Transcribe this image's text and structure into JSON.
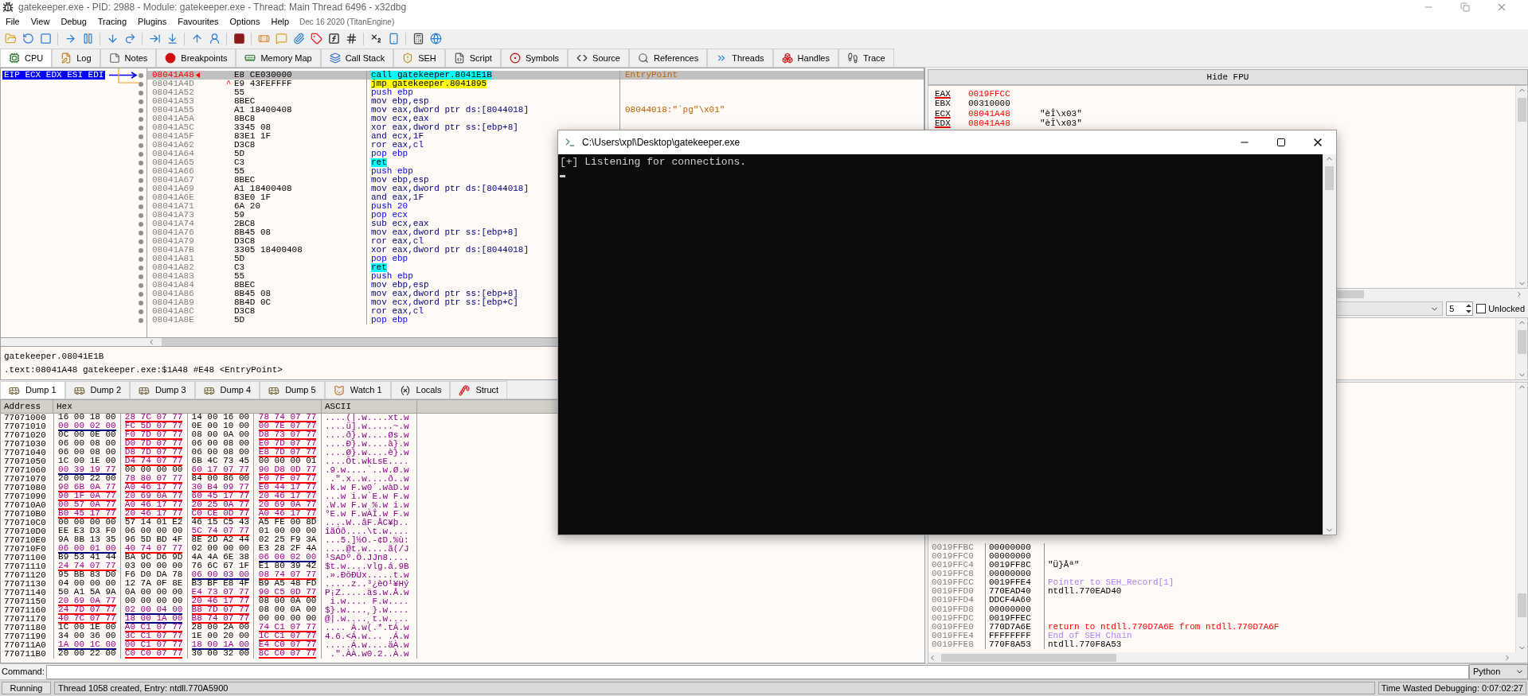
{
  "window": {
    "title": "gatekeeper.exe - PID: 2988 - Module: gatekeeper.exe - Thread: Main Thread 6496 - x32dbg"
  },
  "menu": [
    "File",
    "View",
    "Debug",
    "Tracing",
    "Plugins",
    "Favourites",
    "Options",
    "Help"
  ],
  "build_info": "Dec 16 2020 (TitanEngine)",
  "tabs": [
    {
      "label": "CPU",
      "selected": true
    },
    {
      "label": "Log",
      "selected": false
    },
    {
      "label": "Notes",
      "selected": false
    },
    {
      "label": "Breakpoints",
      "selected": false
    },
    {
      "label": "Memory Map",
      "selected": false
    },
    {
      "label": "Call Stack",
      "selected": false
    },
    {
      "label": "SEH",
      "selected": false
    },
    {
      "label": "Script",
      "selected": false
    },
    {
      "label": "Symbols",
      "selected": false
    },
    {
      "label": "Source",
      "selected": false
    },
    {
      "label": "References",
      "selected": false
    },
    {
      "label": "Threads",
      "selected": false
    },
    {
      "label": "Handles",
      "selected": false
    },
    {
      "label": "Trace",
      "selected": false
    }
  ],
  "disassembly": {
    "register_label": "EIP ECX EDX ESI EDI",
    "rows": [
      {
        "address": "08041A48",
        "bytes": "E8 CE030000",
        "instruction": "call gatekeeper.8041E1B",
        "kind": "call",
        "comment": "EntryPoint",
        "selected": true
      },
      {
        "address": "08041A4D",
        "marker": "^",
        "bytes": "E9 43FEFFFF",
        "instruction": "jmp gatekeeper.8041895",
        "kind": "jmp",
        "selected": false
      },
      {
        "address": "08041A52",
        "bytes": "55",
        "instruction": "push ebp",
        "kind": "stack",
        "selected": false
      },
      {
        "address": "08041A53",
        "bytes": "8BEC",
        "instruction": "mov ebp,esp",
        "kind": "op",
        "selected": false
      },
      {
        "address": "08041A55",
        "bytes": "A1 18400408",
        "instruction": "mov eax,dword ptr ds:[8044018]",
        "kind": "op",
        "comment": "08044018:\"`pg\"\\x01\"",
        "selected": false
      },
      {
        "address": "08041A5A",
        "bytes": "8BC8",
        "instruction": "mov ecx,eax",
        "kind": "op",
        "selected": false
      },
      {
        "address": "08041A5C",
        "bytes": "3345 08",
        "instruction": "xor eax,dword ptr ss:[ebp+8]",
        "kind": "op",
        "selected": false
      },
      {
        "address": "08041A5F",
        "bytes": "83E1 1F",
        "instruction": "and ecx,1F",
        "kind": "op",
        "selected": false
      },
      {
        "address": "08041A62",
        "bytes": "D3C8",
        "instruction": "ror eax,cl",
        "kind": "op",
        "selected": false
      },
      {
        "address": "08041A64",
        "bytes": "5D",
        "instruction": "pop ebp",
        "kind": "stack",
        "selected": false
      },
      {
        "address": "08041A65",
        "bytes": "C3",
        "instruction": "ret",
        "kind": "ret",
        "selected": false
      },
      {
        "address": "08041A66",
        "bytes": "55",
        "instruction": "push ebp",
        "kind": "stack",
        "selected": false
      },
      {
        "address": "08041A67",
        "bytes": "8BEC",
        "instruction": "mov ebp,esp",
        "kind": "op",
        "selected": false
      },
      {
        "address": "08041A69",
        "bytes": "A1 18400408",
        "instruction": "mov eax,dword ptr ds:[8044018]",
        "kind": "op",
        "selected": false
      },
      {
        "address": "08041A6E",
        "bytes": "83E0 1F",
        "instruction": "and eax,1F",
        "kind": "op",
        "selected": false
      },
      {
        "address": "08041A71",
        "bytes": "6A 20",
        "instruction": "push 20",
        "kind": "stack",
        "selected": false
      },
      {
        "address": "08041A73",
        "bytes": "59",
        "instruction": "pop ecx",
        "kind": "stack",
        "selected": false
      },
      {
        "address": "08041A74",
        "bytes": "2BC8",
        "instruction": "sub ecx,eax",
        "kind": "op",
        "selected": false
      },
      {
        "address": "08041A76",
        "bytes": "8B45 08",
        "instruction": "mov eax,dword ptr ss:[ebp+8]",
        "kind": "op",
        "selected": false
      },
      {
        "address": "08041A79",
        "bytes": "D3C8",
        "instruction": "ror eax,cl",
        "kind": "op",
        "selected": false
      },
      {
        "address": "08041A7B",
        "bytes": "3305 18400408",
        "instruction": "xor eax,dword ptr ds:[8044018]",
        "kind": "op",
        "selected": false
      },
      {
        "address": "08041A81",
        "bytes": "5D",
        "instruction": "pop ebp",
        "kind": "stack",
        "selected": false
      },
      {
        "address": "08041A82",
        "bytes": "C3",
        "instruction": "ret",
        "kind": "ret",
        "selected": false
      },
      {
        "address": "08041A83",
        "bytes": "55",
        "instruction": "push ebp",
        "kind": "stack",
        "selected": false
      },
      {
        "address": "08041A84",
        "bytes": "8BEC",
        "instruction": "mov ebp,esp",
        "kind": "op",
        "selected": false
      },
      {
        "address": "08041A86",
        "bytes": "8B45 08",
        "instruction": "mov eax,dword ptr ss:[ebp+8]",
        "kind": "op",
        "selected": false
      },
      {
        "address": "08041A89",
        "bytes": "8B4D 0C",
        "instruction": "mov ecx,dword ptr ss:[ebp+C]",
        "kind": "op",
        "selected": false
      },
      {
        "address": "08041A8C",
        "bytes": "D3C8",
        "instruction": "ror eax,cl",
        "kind": "op",
        "selected": false
      },
      {
        "address": "08041A8E",
        "bytes": "5D",
        "instruction": "pop ebp",
        "kind": "stack",
        "selected": false
      }
    ]
  },
  "info": [
    "gatekeeper.08041E1B",
    ".text:08041A48 gatekeeper.exe:$1A48 #E48 <EntryPoint>"
  ],
  "registers": {
    "button": "Hide FPU",
    "rows": [
      {
        "name": "EAX",
        "value": "0019FFCC",
        "changed": true
      },
      {
        "name": "EBX",
        "value": "00310000",
        "changed": false
      },
      {
        "name": "ECX",
        "value": "08041A48",
        "comment": "\"èÎ\\x03\"",
        "changed": true
      },
      {
        "name": "EDX",
        "value": "08041A48",
        "comment": "\"èÎ\\x03\"",
        "changed": true
      }
    ],
    "arg_count": "5",
    "lock": {
      "label": "Unlocked",
      "checked": false
    }
  },
  "dump": {
    "tabs": [
      {
        "label": "Dump 1",
        "selected": true
      },
      {
        "label": "Dump 2",
        "selected": false
      },
      {
        "label": "Dump 3",
        "selected": false
      },
      {
        "label": "Dump 4",
        "selected": false
      },
      {
        "label": "Dump 5",
        "selected": false
      },
      {
        "label": "Watch 1",
        "selected": false
      },
      {
        "label": "Locals",
        "selected": false
      },
      {
        "label": "Struct",
        "selected": false
      }
    ],
    "columns": [
      "Address",
      "Hex",
      "ASCII"
    ],
    "rows": [
      {
        "address": "77071000",
        "groups": [
          {
            "bytes": "16 00 18 00"
          },
          {
            "bytes": "28 7C 07 77",
            "color": "#ff0000"
          },
          {
            "bytes": "14 00 16 00"
          },
          {
            "bytes": "78 74 07 77",
            "color": "#ff0000"
          }
        ],
        "ascii": "....(|.w....xt.w"
      },
      {
        "address": "77071010",
        "groups": [
          {
            "bytes": "00 00 02 00",
            "color": "#000080"
          },
          {
            "bytes": "FC 5D 07 77",
            "color": "#ff0000"
          },
          {
            "bytes": "0E 00 10 00"
          },
          {
            "bytes": "00 7E 07 77",
            "color": "#ff0000"
          }
        ],
        "ascii": "....ü].w.....~.w"
      },
      {
        "address": "77071020",
        "groups": [
          {
            "bytes": "0C 00 0E 00"
          },
          {
            "bytes": "F0 7D 07 77",
            "color": "#ff0000"
          },
          {
            "bytes": "08 00 0A 00"
          },
          {
            "bytes": "D8 73 07 77",
            "color": "#ff0000"
          }
        ],
        "ascii": "....ð}.w....Øs.w"
      },
      {
        "address": "77071030",
        "groups": [
          {
            "bytes": "06 00 08 00"
          },
          {
            "bytes": "D0 7D 07 77",
            "color": "#ff0000"
          },
          {
            "bytes": "06 00 08 00"
          },
          {
            "bytes": "E0 7D 07 77",
            "color": "#ff0000"
          }
        ],
        "ascii": "....Ð}.w....à}.w"
      },
      {
        "address": "77071040",
        "groups": [
          {
            "bytes": "06 00 08 00"
          },
          {
            "bytes": "D8 7D 07 77",
            "color": "#ff0000"
          },
          {
            "bytes": "06 00 08 00"
          },
          {
            "bytes": "E8 7D 07 77",
            "color": "#ff0000"
          }
        ],
        "ascii": "....Ø}.w....è}.w"
      },
      {
        "address": "77071050",
        "groups": [
          {
            "bytes": "1C 00 1E 00"
          },
          {
            "bytes": "D4 74 07 77",
            "color": "#ff0000"
          },
          {
            "bytes": "6B 4C 73 45"
          },
          {
            "bytes": "00 00 00 01"
          }
        ],
        "ascii": "....Ôt.wkLsE...."
      },
      {
        "address": "77071060",
        "groups": [
          {
            "bytes": "00 39 19 77",
            "color": "#000080"
          },
          {
            "bytes": "00 00 00 00"
          },
          {
            "bytes": "60 17 07 77",
            "color": "#ff0000"
          },
          {
            "bytes": "90 D8 0D 77",
            "color": "#ff0000"
          }
        ],
        "ascii": ".9.w....`..w.Ø.w"
      },
      {
        "address": "77071070",
        "groups": [
          {
            "bytes": "20 00 22 00"
          },
          {
            "bytes": "78 80 07 77",
            "color": "#ff0000"
          },
          {
            "bytes": "84 00 86 00"
          },
          {
            "bytes": "F0 7F 07 77",
            "color": "#ff0000"
          }
        ],
        "ascii": " .\".x..w....ð..w"
      },
      {
        "address": "77071080",
        "groups": [
          {
            "bytes": "90 6B 0A 77",
            "color": "#ff0000"
          },
          {
            "bytes": "A0 46 17 77",
            "color": "#ff0000"
          },
          {
            "bytes": "30 B4 09 77",
            "color": "#ff0000"
          },
          {
            "bytes": "E0 44 17 77",
            "color": "#ff0000"
          }
        ],
        "ascii": ".k.w F.w0´.wàD.w"
      },
      {
        "address": "77071090",
        "groups": [
          {
            "bytes": "90 1F 0A 77",
            "color": "#ff0000"
          },
          {
            "bytes": "20 69 0A 77",
            "color": "#ff0000"
          },
          {
            "bytes": "60 45 17 77",
            "color": "#ff0000"
          },
          {
            "bytes": "20 46 17 77",
            "color": "#ff0000"
          }
        ],
        "ascii": "...w i.w`E.w F.w"
      },
      {
        "address": "770710A0",
        "groups": [
          {
            "bytes": "00 57 0A 77",
            "color": "#ff0000"
          },
          {
            "bytes": "A0 46 17 77",
            "color": "#ff0000"
          },
          {
            "bytes": "20 25 0A 77",
            "color": "#ff0000"
          },
          {
            "bytes": "20 69 0A 77",
            "color": "#ff0000"
          }
        ],
        "ascii": ".W.w F.w %.w i.w"
      },
      {
        "address": "770710B0",
        "groups": [
          {
            "bytes": "B0 45 17 77",
            "color": "#ff0000"
          },
          {
            "bytes": "20 46 17 77",
            "color": "#ff0000"
          },
          {
            "bytes": "C0 CE 0D 77",
            "color": "#ff0000"
          },
          {
            "bytes": "A0 46 17 77",
            "color": "#ff0000"
          }
        ],
        "ascii": "°E.w F.wÀÎ.w F.w"
      },
      {
        "address": "770710C0",
        "groups": [
          {
            "bytes": "00 00 00 00"
          },
          {
            "bytes": "57 14 01 E2"
          },
          {
            "bytes": "46 15 C5 43"
          },
          {
            "bytes": "A5 FE 00 8D"
          }
        ],
        "ascii": "....W..âF.ÅC¥þ.."
      },
      {
        "address": "770710D0",
        "groups": [
          {
            "bytes": "EE E3 D3 F0"
          },
          {
            "bytes": "06 00 00 00"
          },
          {
            "bytes": "5C 74 07 77",
            "color": "#ff0000"
          },
          {
            "bytes": "01 00 00 00"
          }
        ],
        "ascii": "îãÓð....\\t.w...."
      },
      {
        "address": "770710E0",
        "groups": [
          {
            "bytes": "9A 8B 13 35"
          },
          {
            "bytes": "96 5D BD 4F"
          },
          {
            "bytes": "8E 2D A2 44"
          },
          {
            "bytes": "02 25 F9 3A"
          }
        ],
        "ascii": "...5.]½O.-¢D.%ù:"
      },
      {
        "address": "770710F0",
        "groups": [
          {
            "bytes": "06 00 01 00",
            "color": "#000080"
          },
          {
            "bytes": "40 74 07 77",
            "color": "#ff0000"
          },
          {
            "bytes": "02 00 00 00"
          },
          {
            "bytes": "E3 28 2F 4A"
          }
        ],
        "ascii": "....@t.w....ã(/J"
      },
      {
        "address": "77071100",
        "groups": [
          {
            "bytes": "B9 53 41 44"
          },
          {
            "bytes": "BA 9C D6 9D"
          },
          {
            "bytes": "4A 4A 6E 38"
          },
          {
            "bytes": "06 00 02 00",
            "color": "#000080"
          }
        ],
        "ascii": "¹SADº.Ö.JJn8...."
      },
      {
        "address": "77071110",
        "groups": [
          {
            "bytes": "24 74 07 77",
            "color": "#ff0000"
          },
          {
            "bytes": "03 00 00 00"
          },
          {
            "bytes": "76 6C 67 1F"
          },
          {
            "bytes": "E1 80 39 42"
          }
        ],
        "ascii": "$t.w....vlg.á.9B"
      },
      {
        "address": "77071120",
        "groups": [
          {
            "bytes": "95 BB 83 D0"
          },
          {
            "bytes": "F6 D0 DA 78"
          },
          {
            "bytes": "06 00 03 00",
            "color": "#000080"
          },
          {
            "bytes": "08 74 07 77",
            "color": "#ff0000"
          }
        ],
        "ascii": ".».ÐöÐÚx.....t.w"
      },
      {
        "address": "77071130",
        "groups": [
          {
            "bytes": "04 00 00 00"
          },
          {
            "bytes": "12 7A 0F 8E"
          },
          {
            "bytes": "B3 BF E8 4F"
          },
          {
            "bytes": "B9 A5 48 FD"
          }
        ],
        "ascii": ".....z..³¿èO¹¥Hý"
      },
      {
        "address": "77071140",
        "groups": [
          {
            "bytes": "50 A1 5A 9A"
          },
          {
            "bytes": "0A 00 00 00"
          },
          {
            "bytes": "E4 73 07 77",
            "color": "#ff0000"
          },
          {
            "bytes": "90 C5 0D 77",
            "color": "#ff0000"
          }
        ],
        "ascii": "P¡Z.....äs.w.Å.w"
      },
      {
        "address": "77071150",
        "groups": [
          {
            "bytes": "20 69 0A 77",
            "color": "#ff0000"
          },
          {
            "bytes": "00 00 00 00"
          },
          {
            "bytes": "20 46 17 77",
            "color": "#ff0000"
          },
          {
            "bytes": "08 00 0A 00"
          }
        ],
        "ascii": " i.w.... F.w...."
      },
      {
        "address": "77071160",
        "groups": [
          {
            "bytes": "24 7D 07 77",
            "color": "#ff0000"
          },
          {
            "bytes": "02 00 04 00",
            "color": "#000080"
          },
          {
            "bytes": "B8 7D 07 77",
            "color": "#ff0000"
          },
          {
            "bytes": "08 00 0A 00"
          }
        ],
        "ascii": "$}.w....¸}.w...."
      },
      {
        "address": "77071170",
        "groups": [
          {
            "bytes": "40 7C 07 77",
            "color": "#ff0000"
          },
          {
            "bytes": "18 00 1A 00",
            "color": "#000080"
          },
          {
            "bytes": "B8 74 07 77",
            "color": "#ff0000"
          },
          {
            "bytes": "00 00 00 00"
          }
        ],
        "ascii": "@|.w....¸t.w...."
      },
      {
        "address": "77071180",
        "groups": [
          {
            "bytes": "1C 00 1E 00"
          },
          {
            "bytes": "A0 C1 07 77",
            "color": "#ff0000"
          },
          {
            "bytes": "28 00 2A 00"
          },
          {
            "bytes": "74 C1 07 77",
            "color": "#ff0000"
          }
        ],
        "ascii": ".... Á.w(.*.tÁ.w"
      },
      {
        "address": "77071190",
        "groups": [
          {
            "bytes": "34 00 36 00"
          },
          {
            "bytes": "3C C1 07 77",
            "color": "#ff0000"
          },
          {
            "bytes": "1E 00 20 00"
          },
          {
            "bytes": "1C C1 07 77",
            "color": "#ff0000"
          }
        ],
        "ascii": "4.6.<Á.w... .Á.w"
      },
      {
        "address": "770711A0",
        "groups": [
          {
            "bytes": "1A 00 1C 00",
            "color": "#000080"
          },
          {
            "bytes": "00 C1 07 77",
            "color": "#ff0000"
          },
          {
            "bytes": "18 00 1A 00",
            "color": "#000080"
          },
          {
            "bytes": "E4 C0 07 77",
            "color": "#ff0000"
          }
        ],
        "ascii": ".....Á.w....äÀ.w"
      },
      {
        "address": "770711B0",
        "groups": [
          {
            "bytes": "20 00 22 00"
          },
          {
            "bytes": "C0 C0 07 77",
            "color": "#ff0000"
          },
          {
            "bytes": "30 00 32 00"
          },
          {
            "bytes": "8C C0 07 77",
            "color": "#ff0000"
          }
        ],
        "ascii": " .\".ÀÀ.w0.2..À.w"
      }
    ]
  },
  "stack": {
    "rows": [
      {
        "address": "0019FFBC",
        "value": "00000000"
      },
      {
        "address": "0019FFC0",
        "value": "00000000"
      },
      {
        "address": "0019FFC4",
        "value": "0019FF8C",
        "comment": "\"Ü}Åª\"",
        "kind": "plain"
      },
      {
        "address": "0019FFC8",
        "value": "00000000"
      },
      {
        "address": "0019FFCC",
        "value": "0019FFE4",
        "comment": "Pointer to SEH_Record[1]",
        "kind": "seh"
      },
      {
        "address": "0019FFD0",
        "value": "770EAD40",
        "comment": "ntdll.770EAD40",
        "kind": "plain"
      },
      {
        "address": "0019FFD4",
        "value": "DDCF4A60"
      },
      {
        "address": "0019FFD8",
        "value": "00000000"
      },
      {
        "address": "0019FFDC",
        "value": "0019FFEC"
      },
      {
        "address": "0019FFE0",
        "value": "770D7A6E",
        "comment": "return to ntdll.770D7A6E from ntdll.770D7A6F",
        "kind": "return"
      },
      {
        "address": "0019FFE4",
        "value": "FFFFFFFF",
        "comment": "End of SEH Chain",
        "kind": "seh"
      },
      {
        "address": "0019FFE8",
        "value": "770F8A53",
        "comment": "ntdll.770F8A53",
        "kind": "plain"
      }
    ]
  },
  "command": {
    "label": "Command:",
    "language": "Python"
  },
  "status": {
    "state": "Running",
    "message": "Thread 1058 created, Entry: ntdll.770A5900",
    "timer": "Time Wasted Debugging: 0:07:02:27"
  },
  "console": {
    "title": "C:\\Users\\xpl\\Desktop\\gatekeeper.exe",
    "lines": [
      "[+] Listening for connections."
    ]
  }
}
